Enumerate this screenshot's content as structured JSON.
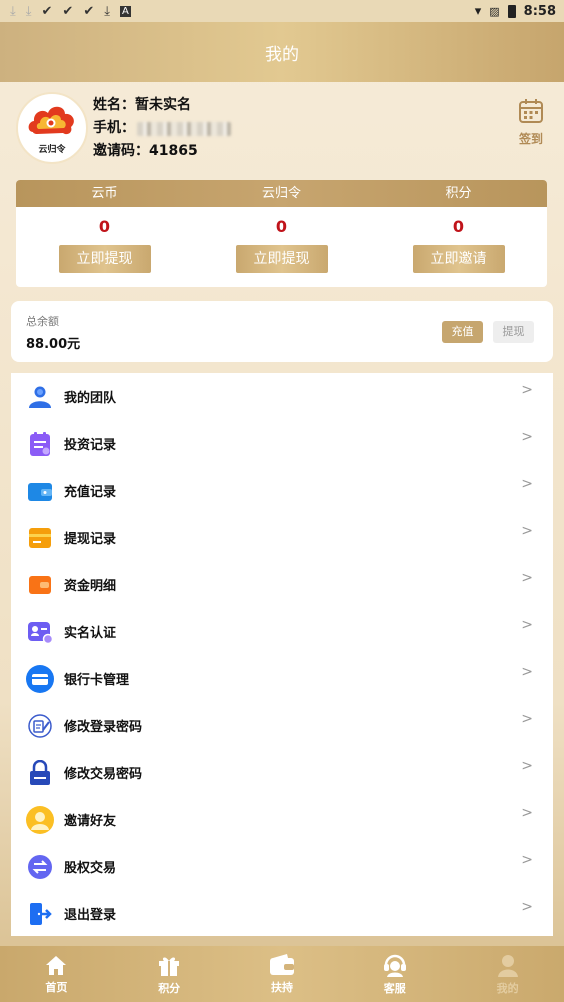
{
  "status_bar": {
    "time": "8:58"
  },
  "header": {
    "title": "我的"
  },
  "profile": {
    "avatar_text": "云归令",
    "name_label": "姓名：",
    "name_value": "暂未实名",
    "phone_label": "手机：",
    "invite_label": "邀请码：",
    "invite_code": "41865",
    "signin_label": "签到"
  },
  "stats": {
    "columns": [
      {
        "title": "云币",
        "value": "0",
        "button": "立即提现"
      },
      {
        "title": "云归令",
        "value": "0",
        "button": "立即提现"
      },
      {
        "title": "积分",
        "value": "0",
        "button": "立即邀请"
      }
    ]
  },
  "balance": {
    "label": "总余额",
    "value": "88.00元",
    "recharge_label": "充值",
    "withdraw_label": "提现"
  },
  "menu": {
    "items": [
      {
        "label": "我的团队",
        "icon": "team-icon"
      },
      {
        "label": "投资记录",
        "icon": "investment-record-icon"
      },
      {
        "label": "充值记录",
        "icon": "wallet-icon"
      },
      {
        "label": "提现记录",
        "icon": "withdraw-record-icon"
      },
      {
        "label": "资金明细",
        "icon": "funds-detail-icon"
      },
      {
        "label": "实名认证",
        "icon": "id-card-icon"
      },
      {
        "label": "银行卡管理",
        "icon": "bank-card-icon"
      },
      {
        "label": "修改登录密码",
        "icon": "edit-password-icon"
      },
      {
        "label": "修改交易密码",
        "icon": "lock-icon"
      },
      {
        "label": "邀请好友",
        "icon": "invite-friend-icon"
      },
      {
        "label": "股权交易",
        "icon": "exchange-icon"
      },
      {
        "label": "退出登录",
        "icon": "logout-icon"
      }
    ],
    "arrow": ">"
  },
  "bottom_nav": {
    "items": [
      {
        "label": "首页",
        "icon": "home-icon"
      },
      {
        "label": "积分",
        "icon": "gift-icon"
      },
      {
        "label": "扶持",
        "icon": "wallet-icon"
      },
      {
        "label": "客服",
        "icon": "customer-service-icon"
      },
      {
        "label": "我的",
        "icon": "user-icon"
      }
    ]
  }
}
